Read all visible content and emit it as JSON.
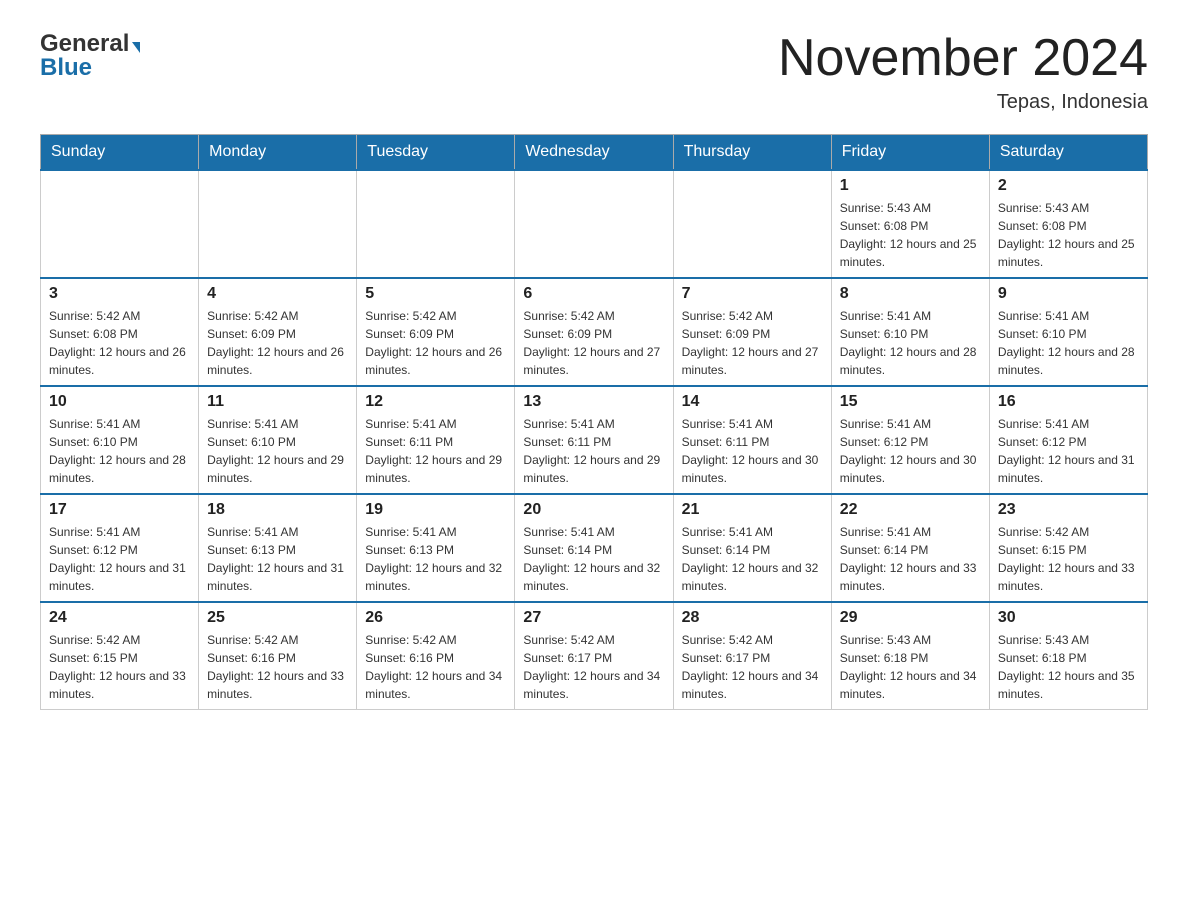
{
  "header": {
    "logo_general": "General",
    "logo_blue": "Blue",
    "month_title": "November 2024",
    "location": "Tepas, Indonesia"
  },
  "days_of_week": [
    "Sunday",
    "Monday",
    "Tuesday",
    "Wednesday",
    "Thursday",
    "Friday",
    "Saturday"
  ],
  "weeks": [
    {
      "days": [
        {
          "num": "",
          "info": ""
        },
        {
          "num": "",
          "info": ""
        },
        {
          "num": "",
          "info": ""
        },
        {
          "num": "",
          "info": ""
        },
        {
          "num": "",
          "info": ""
        },
        {
          "num": "1",
          "info": "Sunrise: 5:43 AM\nSunset: 6:08 PM\nDaylight: 12 hours and 25 minutes."
        },
        {
          "num": "2",
          "info": "Sunrise: 5:43 AM\nSunset: 6:08 PM\nDaylight: 12 hours and 25 minutes."
        }
      ]
    },
    {
      "days": [
        {
          "num": "3",
          "info": "Sunrise: 5:42 AM\nSunset: 6:08 PM\nDaylight: 12 hours and 26 minutes."
        },
        {
          "num": "4",
          "info": "Sunrise: 5:42 AM\nSunset: 6:09 PM\nDaylight: 12 hours and 26 minutes."
        },
        {
          "num": "5",
          "info": "Sunrise: 5:42 AM\nSunset: 6:09 PM\nDaylight: 12 hours and 26 minutes."
        },
        {
          "num": "6",
          "info": "Sunrise: 5:42 AM\nSunset: 6:09 PM\nDaylight: 12 hours and 27 minutes."
        },
        {
          "num": "7",
          "info": "Sunrise: 5:42 AM\nSunset: 6:09 PM\nDaylight: 12 hours and 27 minutes."
        },
        {
          "num": "8",
          "info": "Sunrise: 5:41 AM\nSunset: 6:10 PM\nDaylight: 12 hours and 28 minutes."
        },
        {
          "num": "9",
          "info": "Sunrise: 5:41 AM\nSunset: 6:10 PM\nDaylight: 12 hours and 28 minutes."
        }
      ]
    },
    {
      "days": [
        {
          "num": "10",
          "info": "Sunrise: 5:41 AM\nSunset: 6:10 PM\nDaylight: 12 hours and 28 minutes."
        },
        {
          "num": "11",
          "info": "Sunrise: 5:41 AM\nSunset: 6:10 PM\nDaylight: 12 hours and 29 minutes."
        },
        {
          "num": "12",
          "info": "Sunrise: 5:41 AM\nSunset: 6:11 PM\nDaylight: 12 hours and 29 minutes."
        },
        {
          "num": "13",
          "info": "Sunrise: 5:41 AM\nSunset: 6:11 PM\nDaylight: 12 hours and 29 minutes."
        },
        {
          "num": "14",
          "info": "Sunrise: 5:41 AM\nSunset: 6:11 PM\nDaylight: 12 hours and 30 minutes."
        },
        {
          "num": "15",
          "info": "Sunrise: 5:41 AM\nSunset: 6:12 PM\nDaylight: 12 hours and 30 minutes."
        },
        {
          "num": "16",
          "info": "Sunrise: 5:41 AM\nSunset: 6:12 PM\nDaylight: 12 hours and 31 minutes."
        }
      ]
    },
    {
      "days": [
        {
          "num": "17",
          "info": "Sunrise: 5:41 AM\nSunset: 6:12 PM\nDaylight: 12 hours and 31 minutes."
        },
        {
          "num": "18",
          "info": "Sunrise: 5:41 AM\nSunset: 6:13 PM\nDaylight: 12 hours and 31 minutes."
        },
        {
          "num": "19",
          "info": "Sunrise: 5:41 AM\nSunset: 6:13 PM\nDaylight: 12 hours and 32 minutes."
        },
        {
          "num": "20",
          "info": "Sunrise: 5:41 AM\nSunset: 6:14 PM\nDaylight: 12 hours and 32 minutes."
        },
        {
          "num": "21",
          "info": "Sunrise: 5:41 AM\nSunset: 6:14 PM\nDaylight: 12 hours and 32 minutes."
        },
        {
          "num": "22",
          "info": "Sunrise: 5:41 AM\nSunset: 6:14 PM\nDaylight: 12 hours and 33 minutes."
        },
        {
          "num": "23",
          "info": "Sunrise: 5:42 AM\nSunset: 6:15 PM\nDaylight: 12 hours and 33 minutes."
        }
      ]
    },
    {
      "days": [
        {
          "num": "24",
          "info": "Sunrise: 5:42 AM\nSunset: 6:15 PM\nDaylight: 12 hours and 33 minutes."
        },
        {
          "num": "25",
          "info": "Sunrise: 5:42 AM\nSunset: 6:16 PM\nDaylight: 12 hours and 33 minutes."
        },
        {
          "num": "26",
          "info": "Sunrise: 5:42 AM\nSunset: 6:16 PM\nDaylight: 12 hours and 34 minutes."
        },
        {
          "num": "27",
          "info": "Sunrise: 5:42 AM\nSunset: 6:17 PM\nDaylight: 12 hours and 34 minutes."
        },
        {
          "num": "28",
          "info": "Sunrise: 5:42 AM\nSunset: 6:17 PM\nDaylight: 12 hours and 34 minutes."
        },
        {
          "num": "29",
          "info": "Sunrise: 5:43 AM\nSunset: 6:18 PM\nDaylight: 12 hours and 34 minutes."
        },
        {
          "num": "30",
          "info": "Sunrise: 5:43 AM\nSunset: 6:18 PM\nDaylight: 12 hours and 35 minutes."
        }
      ]
    }
  ]
}
